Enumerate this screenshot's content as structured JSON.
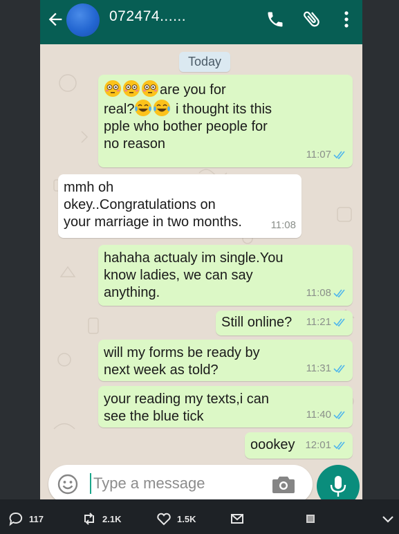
{
  "header": {
    "contact_name": "072474......",
    "icons": [
      "back-arrow-icon",
      "avatar",
      "phone-call-icon",
      "paperclip-icon",
      "more-vertical-icon"
    ],
    "color": "#075e54"
  },
  "date_chip": "Today",
  "messages": [
    {
      "direction": "out",
      "text_a": "are you for",
      "text_b": "real?",
      "text_c": " i thought its this\npple who bother people for\nno reason",
      "time": "11:07"
    },
    {
      "direction": "in",
      "text": "mmh oh\nokey..Congratulations on\nyour marriage in two months.",
      "time": "11:08"
    },
    {
      "direction": "out",
      "text": "hahaha actualy im single.You\nknow ladies, we can say\nanything.",
      "time": "11:08"
    },
    {
      "direction": "out",
      "text": "Still online?",
      "time": "11:21"
    },
    {
      "direction": "out",
      "text": "will my forms be ready by\nnext week as told?",
      "time": "11:31"
    },
    {
      "direction": "out",
      "text": "your reading my texts,i can\nsee the blue tick",
      "time": "11:40"
    },
    {
      "direction": "out",
      "text": "oookey",
      "time": "12:01"
    }
  ],
  "composer": {
    "placeholder": "Type a message"
  },
  "colors": {
    "outgoing_bubble": "#dcf8c6",
    "incoming_bubble": "#ffffff",
    "read_tick": "#4fb6ec",
    "accent": "#0a8d7c"
  },
  "tweet_actions": {
    "replies": "117",
    "retweets": "2.1K",
    "likes": "1.5K"
  }
}
